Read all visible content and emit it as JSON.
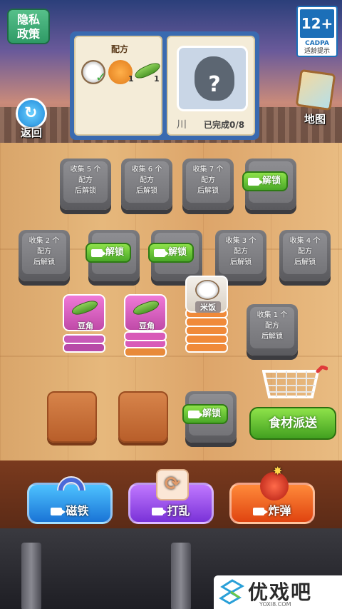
{
  "header": {
    "privacy_label": "隐私\n政策",
    "age_rating": "12+",
    "age_org": "CADPA",
    "age_note": "适龄提示",
    "back_label": "返回",
    "map_label": "地图"
  },
  "recipe": {
    "title": "配方",
    "ingredients": [
      {
        "icon": "rice-bowl-icon",
        "qty": "",
        "done": true
      },
      {
        "icon": "shrimp-icon",
        "qty": "1"
      },
      {
        "icon": "pea-pod-icon",
        "qty": "1"
      }
    ],
    "mystery_mark": "?",
    "side_mark": "川",
    "progress_text": "已完成0/8"
  },
  "slots": {
    "collect5": "收集 5 个\n配方\n后解锁",
    "collect6": "收集 6 个\n配方\n后解锁",
    "collect7": "收集 7 个\n配方\n后解锁",
    "collect2": "收集 2 个\n配方\n后解锁",
    "collect3": "收集 3 个\n配方\n后解锁",
    "collect4": "收集 4 个\n配方\n后解锁",
    "collect1": "收集 1 个\n配方\n后解锁",
    "unlock": "解锁"
  },
  "stacks": {
    "pea1": "豆角",
    "pea2": "豆角",
    "rice": "米饭"
  },
  "delivery_label": "食材派送",
  "tools": {
    "magnet": "磁铁",
    "shuffle": "打乱",
    "bomb": "炸弹"
  },
  "watermark": {
    "name": "优戏吧",
    "url": "YOXI8.COM"
  },
  "colors": {
    "unlock_green": "#5ab82e",
    "magnet_blue": "#1a74d6",
    "shuffle_purple": "#7a32d8",
    "bomb_orange": "#e04410"
  }
}
